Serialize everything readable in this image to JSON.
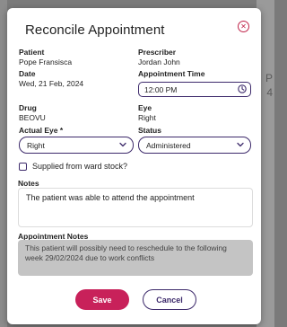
{
  "modal": {
    "title": "Reconcile Appointment",
    "close_icon": "close-icon"
  },
  "fields": {
    "patient_label": "Patient",
    "patient_value": "Pope Fransisca",
    "prescriber_label": "Prescriber",
    "prescriber_value": "Jordan John",
    "date_label": "Date",
    "date_value": "Wed, 21 Feb, 2024",
    "appt_time_label": "Appointment Time",
    "appt_time_value": "12:00 PM",
    "drug_label": "Drug",
    "drug_value": "BEOVU",
    "eye_label": "Eye",
    "eye_value": "Right",
    "actual_eye_label": "Actual Eye *",
    "actual_eye_value": "Right",
    "status_label": "Status",
    "status_value": "Administered"
  },
  "checkbox": {
    "label": "Supplied from ward stock?",
    "checked": false
  },
  "notes": {
    "label": "Notes",
    "value": "The patient was able to attend the appointment"
  },
  "appointment_notes": {
    "label": "Appointment Notes",
    "value": "This patient will possibly need to reschedule to the following week 29/02/2024 due to work conflicts"
  },
  "buttons": {
    "save": "Save",
    "cancel": "Cancel"
  },
  "background": {
    "right_fragments": [
      "P",
      "4"
    ]
  },
  "colors": {
    "accent": "#3d2a6b",
    "primary": "#c8215a",
    "disabled_bg": "#c4c4c4"
  }
}
